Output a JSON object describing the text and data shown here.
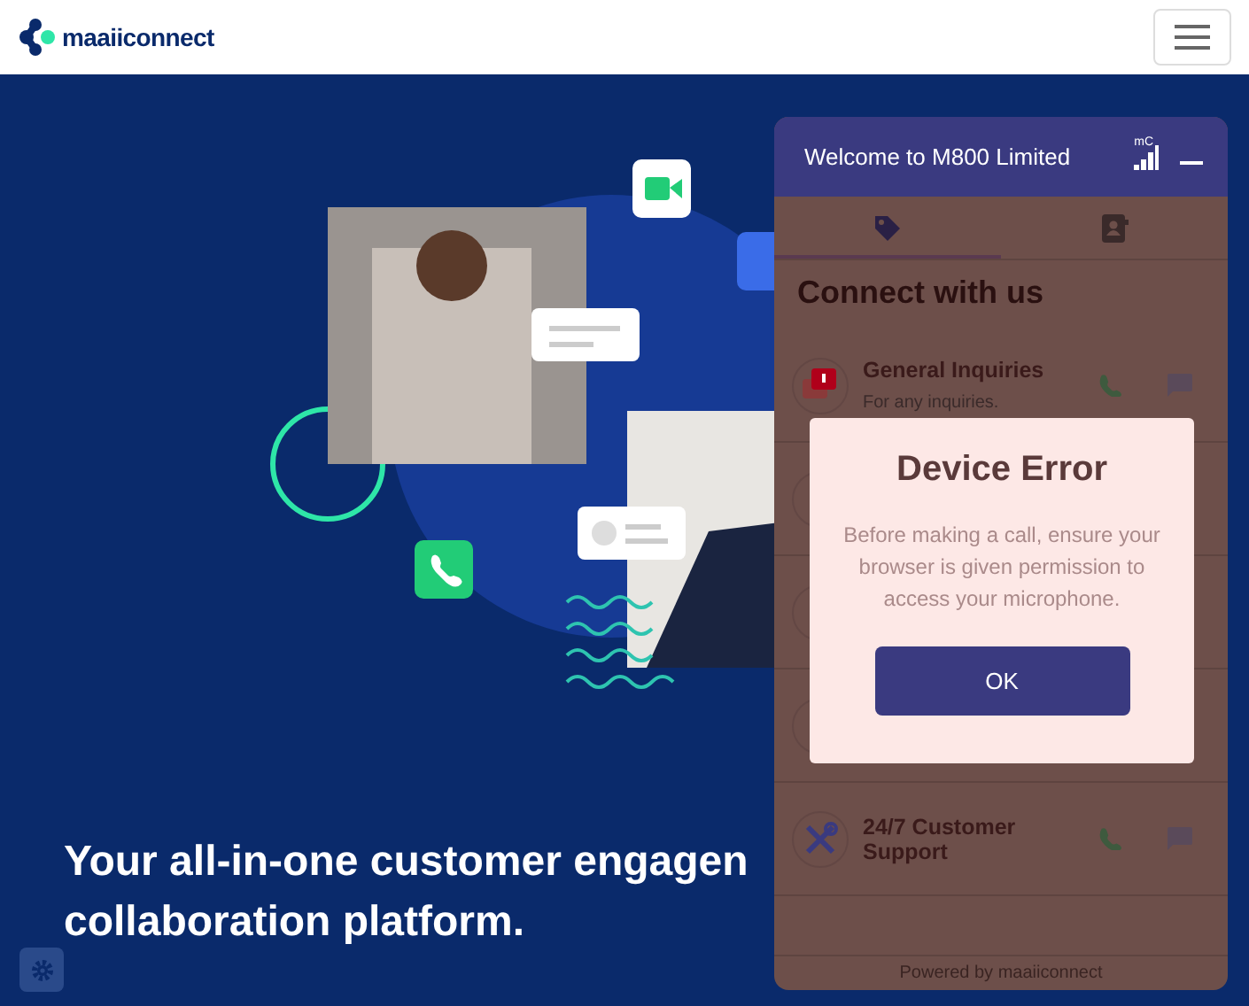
{
  "navbar": {
    "logo_text": "maaiiconnect"
  },
  "hero": {
    "headline_lines": [
      "Your all-in-one customer engagen",
      "collaboration platform."
    ]
  },
  "widget": {
    "title": "Welcome to M800 Limited",
    "signal_label": "mC",
    "tabs": [
      {
        "kind": "tag",
        "selected": true
      },
      {
        "kind": "contact",
        "selected": false
      }
    ],
    "heading": "Connect with us",
    "contacts": [
      {
        "kind": "inquiry",
        "title": "General Inquiries",
        "subtitle": "For any inquiries."
      },
      {
        "kind": "hidden"
      },
      {
        "kind": "hidden"
      },
      {
        "kind": "hidden"
      },
      {
        "kind": "support",
        "title": "24/7 Customer Support"
      }
    ],
    "footer": "Powered by maaiiconnect"
  },
  "dialog": {
    "title": "Device Error",
    "message": "Before making a call, ensure your browser is given permission to access your microphone.",
    "button": "OK"
  }
}
